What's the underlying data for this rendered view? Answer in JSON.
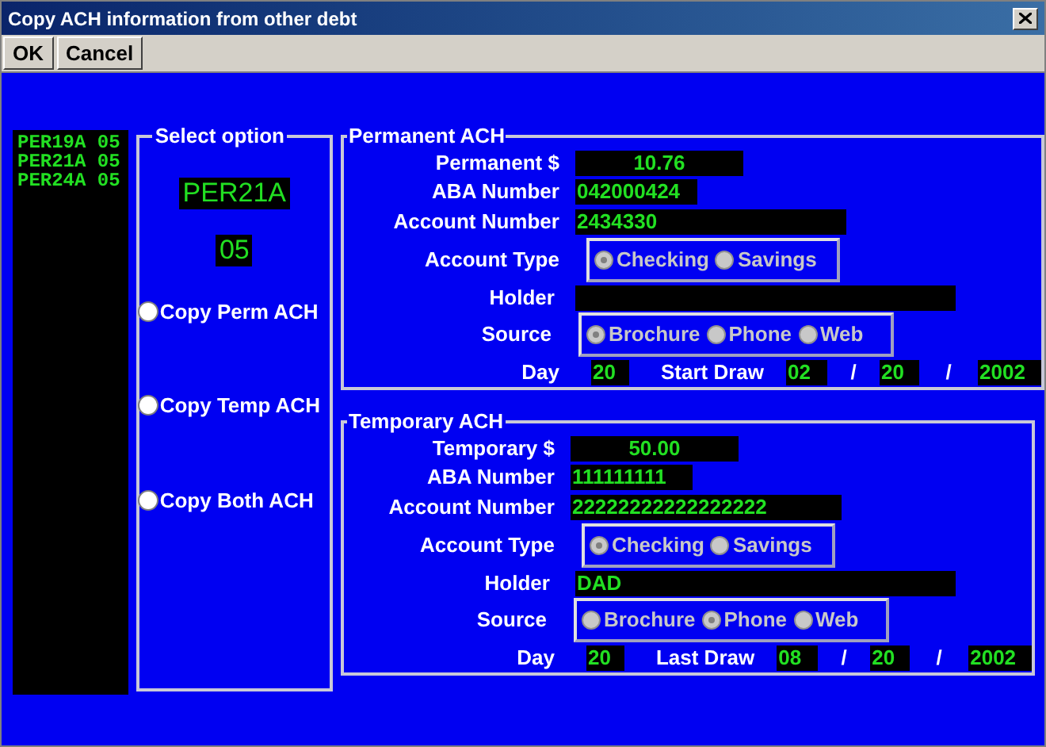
{
  "window": {
    "title": "Copy ACH information from other debt"
  },
  "toolbar": [
    "OK",
    "Cancel"
  ],
  "debt_list": [
    {
      "code": "PER19A",
      "number": "05",
      "selected": false
    },
    {
      "code": "PER21A",
      "number": "05",
      "selected": false
    },
    {
      "code": "PER24A",
      "number": "05",
      "selected": false
    }
  ],
  "select_option": {
    "title": "Select option",
    "code": "PER21A",
    "number": "05",
    "options": [
      {
        "label": "Copy Perm ACH",
        "selected": false
      },
      {
        "label": "Copy Temp ACH",
        "selected": false
      },
      {
        "label": "Copy Both ACH",
        "selected": false
      }
    ]
  },
  "sections": [
    {
      "title": "Permanent ACH",
      "amount": {
        "label": "Permanent $",
        "value": "10.76"
      },
      "aba": {
        "label": "ABA Number",
        "value": "042000424"
      },
      "account": {
        "label": "Account Number",
        "value": "2434330"
      },
      "account_type": {
        "label": "Account Type",
        "options": [
          {
            "label": "Checking",
            "selected": true
          },
          {
            "label": "Savings",
            "selected": false
          }
        ]
      },
      "holder": {
        "label": "Holder"
      },
      "source": {
        "label": "Source",
        "options": [
          {
            "label": "Brochure",
            "selected": true
          },
          {
            "label": "Phone",
            "selected": false
          },
          {
            "label": "Web",
            "selected": false
          }
        ]
      },
      "day": {
        "label": "Day",
        "value": "20"
      },
      "draw": {
        "label": "Start Draw",
        "month": "02",
        "day": "20",
        "year": "2002",
        "separators": [
          "/",
          "/"
        ]
      }
    },
    {
      "title": "Temporary ACH",
      "amount": {
        "label": "Temporary $",
        "value": "50.00"
      },
      "aba": {
        "label": "ABA Number",
        "value": "111111111"
      },
      "account": {
        "label": "Account Number",
        "value": "22222222222222222"
      },
      "account_type": {
        "label": "Account Type",
        "options": [
          {
            "label": "Checking",
            "selected": true
          },
          {
            "label": "Savings",
            "selected": false
          }
        ]
      },
      "holder": {
        "label": "Holder",
        "value": "DAD"
      },
      "source": {
        "label": "Source",
        "options": [
          {
            "label": "Brochure",
            "selected": false
          },
          {
            "label": "Phone",
            "selected": true
          },
          {
            "label": "Web",
            "selected": false
          }
        ]
      },
      "day": {
        "label": "Day",
        "value": "20"
      },
      "draw": {
        "label": "Last Draw",
        "month": "08",
        "day": "20",
        "year": "2002",
        "separators": [
          "/",
          "/"
        ]
      }
    }
  ]
}
